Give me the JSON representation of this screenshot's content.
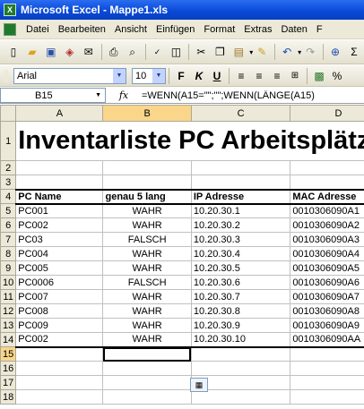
{
  "window": {
    "title": "Microsoft Excel - Mappe1.xls",
    "icon": "excel-icon"
  },
  "menu": [
    "Datei",
    "Bearbeiten",
    "Ansicht",
    "Einfügen",
    "Format",
    "Extras",
    "Daten",
    "F"
  ],
  "toolbar": {
    "icons": [
      "new-document-icon",
      "open-folder-icon",
      "save-icon",
      "permission-icon",
      "mail-icon",
      "print-icon",
      "print-preview-icon",
      "spellcheck-icon",
      "research-icon",
      "cut-icon",
      "copy-icon",
      "paste-icon",
      "format-painter-icon",
      "undo-icon",
      "redo-icon",
      "hyperlink-icon",
      "autosum-icon"
    ]
  },
  "format": {
    "font": "Arial",
    "size": "10",
    "bold": "F",
    "italic": "K",
    "underline": "U"
  },
  "formula_bar": {
    "cell_ref": "B15",
    "fx": "fx",
    "formula": "=WENN(A15=\"\";\"\";WENN(LÄNGE(A15)"
  },
  "sheet": {
    "columns": [
      "A",
      "B",
      "C",
      "D"
    ],
    "rows": [
      "1",
      "2",
      "3",
      "4",
      "5",
      "6",
      "7",
      "8",
      "9",
      "10",
      "11",
      "12",
      "13",
      "14",
      "15",
      "16",
      "17",
      "18"
    ],
    "title": "Inventarliste PC Arbeitsplätze",
    "headers": [
      "PC Name",
      "genau 5 lang",
      "IP Adresse",
      "MAC Adresse"
    ],
    "data": [
      [
        "PC001",
        "WAHR",
        "10.20.30.1",
        "0010306090A1"
      ],
      [
        "PC002",
        "WAHR",
        "10.20.30.2",
        "0010306090A2"
      ],
      [
        "PC03",
        "FALSCH",
        "10.20.30.3",
        "0010306090A3"
      ],
      [
        "PC004",
        "WAHR",
        "10.20.30.4",
        "0010306090A4"
      ],
      [
        "PC005",
        "WAHR",
        "10.20.30.5",
        "0010306090A5"
      ],
      [
        "PC0006",
        "FALSCH",
        "10.20.30.6",
        "0010306090A6"
      ],
      [
        "PC007",
        "WAHR",
        "10.20.30.7",
        "0010306090A7"
      ],
      [
        "PC008",
        "WAHR",
        "10.20.30.8",
        "0010306090A8"
      ],
      [
        "PC009",
        "WAHR",
        "10.20.30.9",
        "0010306090A9"
      ],
      [
        "PC002",
        "WAHR",
        "10.20.30.10",
        "0010306090AA"
      ]
    ]
  }
}
